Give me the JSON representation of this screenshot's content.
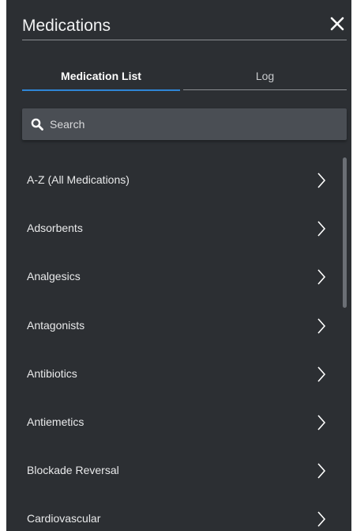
{
  "header": {
    "title": "Medications",
    "close_icon": "close-icon"
  },
  "tabs": [
    {
      "label": "Medication List",
      "active": true
    },
    {
      "label": "Log",
      "active": false
    }
  ],
  "search": {
    "placeholder": "Search",
    "value": "",
    "icon": "search-icon"
  },
  "list": {
    "items": [
      {
        "label": "A-Z (All Medications)"
      },
      {
        "label": "Adsorbents"
      },
      {
        "label": "Analgesics"
      },
      {
        "label": "Antagonists"
      },
      {
        "label": "Antibiotics"
      },
      {
        "label": "Antiemetics"
      },
      {
        "label": "Blockade Reversal"
      },
      {
        "label": "Cardiovascular"
      }
    ],
    "item_icon": "chevron-right-icon"
  },
  "colors": {
    "panel_bg": "#2c2f33",
    "accent": "#2f86d6",
    "search_bg": "#4a4e54",
    "text": "#e9eaeb"
  }
}
